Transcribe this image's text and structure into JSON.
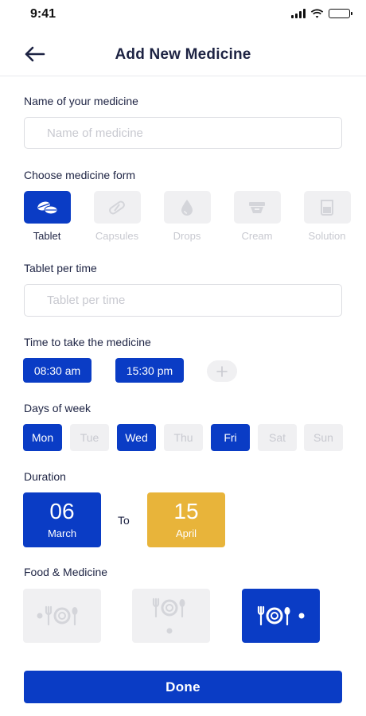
{
  "status_bar": {
    "time": "9:41"
  },
  "header": {
    "title": "Add New Medicine",
    "back_icon": "arrow-left-icon"
  },
  "name_section": {
    "label": "Name of your medicine",
    "placeholder": "Name of medicine",
    "value": ""
  },
  "form_section": {
    "label": "Choose medicine form",
    "options": [
      {
        "label": "Tablet",
        "icon": "tablet-icon",
        "selected": true
      },
      {
        "label": "Capsules",
        "icon": "capsule-icon",
        "selected": false
      },
      {
        "label": "Drops",
        "icon": "drop-icon",
        "selected": false
      },
      {
        "label": "Cream",
        "icon": "cream-icon",
        "selected": false
      },
      {
        "label": "Solution",
        "icon": "solution-icon",
        "selected": false
      }
    ]
  },
  "dose_section": {
    "label": "Tablet per time",
    "placeholder": "Tablet per time",
    "value": ""
  },
  "time_section": {
    "label": "Time to take the medicine",
    "times": [
      "08:30 am",
      "15:30 pm"
    ],
    "add_icon": "plus-icon"
  },
  "days_section": {
    "label": "Days of week",
    "days": [
      {
        "label": "Mon",
        "selected": true
      },
      {
        "label": "Tue",
        "selected": false
      },
      {
        "label": "Wed",
        "selected": true
      },
      {
        "label": "Thu",
        "selected": false
      },
      {
        "label": "Fri",
        "selected": true
      },
      {
        "label": "Sat",
        "selected": false
      },
      {
        "label": "Sun",
        "selected": false
      }
    ]
  },
  "duration_section": {
    "label": "Duration",
    "start": {
      "day": "06",
      "month": "March"
    },
    "separator": "To",
    "end": {
      "day": "15",
      "month": "April"
    }
  },
  "food_section": {
    "label": "Food & Medicine",
    "options": [
      {
        "icon": "before-meal-icon",
        "selected": false
      },
      {
        "icon": "with-meal-icon",
        "selected": false
      },
      {
        "icon": "after-meal-icon",
        "selected": true
      }
    ]
  },
  "done_label": "Done",
  "colors": {
    "primary": "#0a3cc5",
    "accent": "#e8b43a",
    "inactive_bg": "#f0f0f2",
    "inactive_text": "#c8c9d0",
    "text": "#1d2343"
  }
}
